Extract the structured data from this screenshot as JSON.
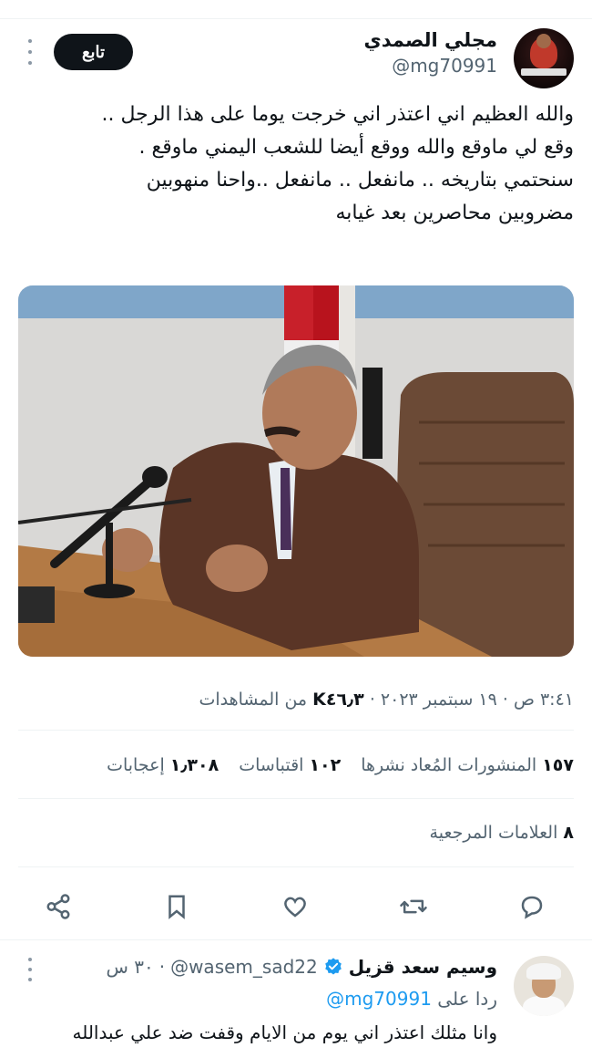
{
  "tweet": {
    "author_name": "مجلي الصمدي",
    "author_handle": "@mg70991",
    "follow_label": "تابع",
    "text_lines": [
      "والله العظيم اني اعتذر اني خرجت يوما على هذا الرجل ..",
      "وقع لي ماوقع والله ووقع أيضا للشعب اليمني ماوقع .",
      "سنحتمي بتاريخه .. مانفعل .. مانفعل ..واحنا منهوبين",
      "مضروبين محاصرين بعد غيابه"
    ],
    "meta": {
      "time_date": "٣:٤١ ص · ١٩ سبتمبر ٢٠٢٣ ·",
      "views_count": "K٤٦٫٣",
      "views_label": "من المشاهدات"
    },
    "stats": {
      "reposts_count": "١٥٧",
      "reposts_label": "المنشورات المُعاد نشرها",
      "quotes_count": "١٠٢",
      "quotes_label": "اقتباسات",
      "likes_count": "١٫٣٠٨",
      "likes_label": "إعجابات"
    },
    "bookmarks": {
      "count": "٨",
      "label": "العلامات المرجعية"
    }
  },
  "actions": {
    "icons": [
      "reply-icon",
      "retweet-icon",
      "like-icon",
      "bookmark-icon",
      "share-icon"
    ]
  },
  "reply": {
    "author_name": "وسيم سعد قزيل",
    "author_handle": "@wasem_sad22",
    "time": "٣٠ س",
    "replying_to_label": "ردا على",
    "replying_to_handle": "@mg70991",
    "text": "وانا مثلك اعتذر اني يوم من الايام وقفت ضد علي عبدالله"
  },
  "colors": {
    "text_primary": "#0f1419",
    "text_secondary": "#536471",
    "accent": "#1d9bf0",
    "button_bg": "#0f1419",
    "divider": "#eff3f4"
  }
}
